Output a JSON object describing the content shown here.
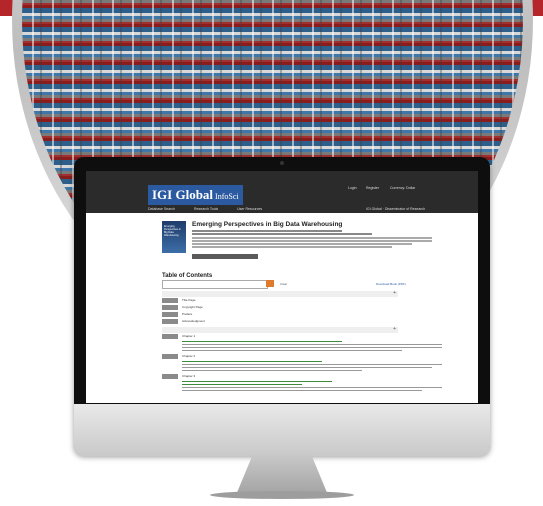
{
  "brand": {
    "logo": "IGI Global",
    "logo_suffix": "InfoSci"
  },
  "utility_nav": [
    "Login",
    "Register",
    "Currency: Dollar"
  ],
  "main_nav": [
    "Database Search",
    "Research Tools",
    "User Resources"
  ],
  "nav_right": "IGI Global · Disseminator of Research",
  "book": {
    "title": "Emerging Perspectives in Big Data Warehousing",
    "cover_title": "Emerging Perspectives in Big Data Warehousing"
  },
  "toc": {
    "heading": "Table of Contents",
    "search_placeholder": "",
    "clear_label": "Clear",
    "download_label": "Download Book (PDF)",
    "rows": [
      {
        "tag": "",
        "text": "Title Page"
      },
      {
        "tag": "",
        "text": "Copyright Page"
      },
      {
        "tag": "",
        "text": "Preface"
      },
      {
        "tag": "",
        "text": "Acknowledgment"
      }
    ],
    "chapters": [
      {
        "label": "Chapter 1"
      },
      {
        "label": "Chapter 2"
      },
      {
        "label": "Chapter 3"
      }
    ]
  },
  "colors": {
    "brand_red": "#b5262a",
    "logo_blue": "#2c5aa0",
    "accent_orange": "#e07a2c"
  }
}
